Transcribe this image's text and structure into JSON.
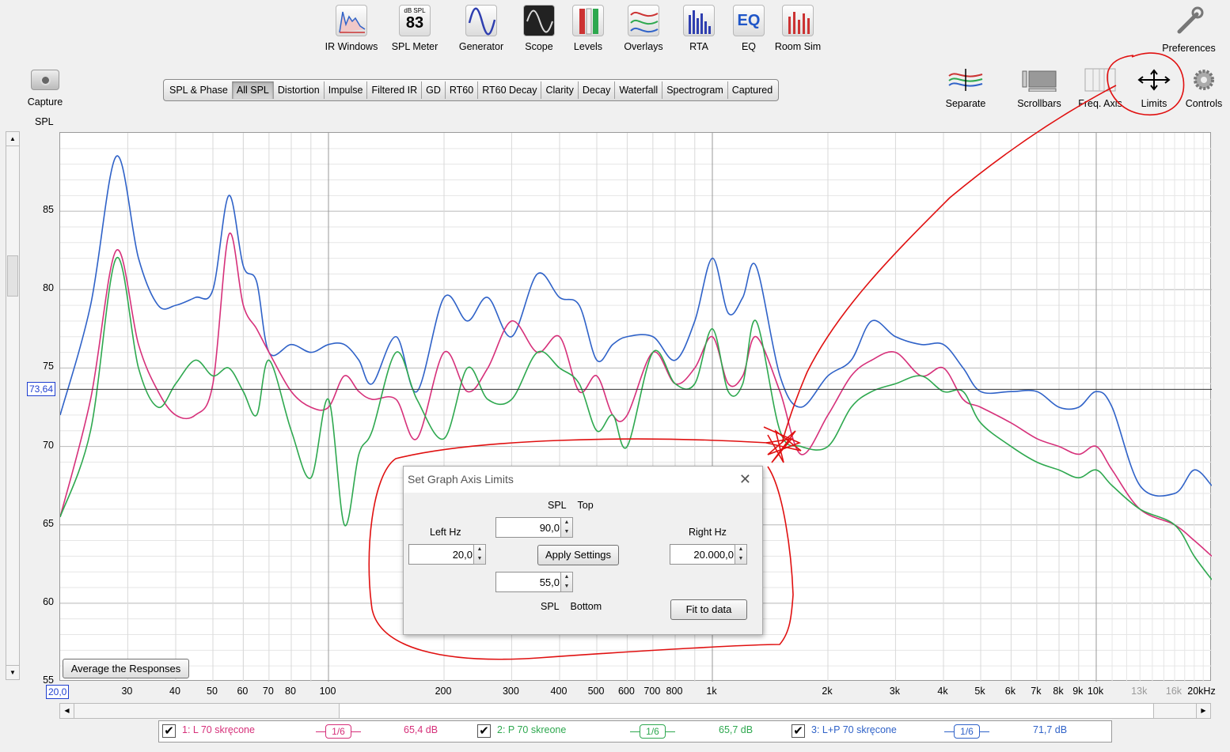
{
  "toolbar": {
    "ir_windows": "IR Windows",
    "spl_meter_top": "dB SPL",
    "spl_meter_value": "83",
    "spl_meter": "SPL Meter",
    "generator": "Generator",
    "scope": "Scope",
    "levels": "Levels",
    "overlays": "Overlays",
    "rta": "RTA",
    "eq_icon": "EQ",
    "eq": "EQ",
    "room_sim": "Room Sim",
    "preferences": "Preferences"
  },
  "capture": "Capture",
  "tabs": [
    "SPL & Phase",
    "All SPL",
    "Distortion",
    "Impulse",
    "Filtered IR",
    "GD",
    "RT60",
    "RT60 Decay",
    "Clarity",
    "Decay",
    "Waterfall",
    "Spectrogram",
    "Captured"
  ],
  "right_tools": {
    "separate": "Separate",
    "scrollbars": "Scrollbars",
    "freq_axis": "Freq. Axis",
    "limits": "Limits",
    "controls": "Controls"
  },
  "axis": {
    "ylabel": "SPL",
    "y_ticks": [
      "85",
      "80",
      "75",
      "70",
      "65",
      "60",
      "55"
    ],
    "x_ticks": [
      "30",
      "40",
      "50",
      "60",
      "70",
      "80",
      "100",
      "200",
      "300",
      "400",
      "500",
      "600",
      "700",
      "800",
      "1k",
      "2k",
      "3k",
      "4k",
      "5k",
      "6k",
      "7k",
      "8k",
      "9k",
      "10k",
      "13k",
      "16k",
      "20kHz"
    ],
    "x_min_box": "20,0",
    "cursor_spl": "73,64"
  },
  "average_button": "Average the Responses",
  "dialog": {
    "title": "Set Graph Axis Limits",
    "spl_top_a": "SPL",
    "spl_top_b": "Top",
    "left_label": "Left Hz",
    "left_value": "20,0",
    "top_value": "90,0",
    "apply": "Apply Settings",
    "right_label": "Right Hz",
    "right_value": "20.000,0",
    "bottom_value": "55,0",
    "spl_bottom_a": "SPL",
    "spl_bottom_b": "Bottom",
    "fit": "Fit to data"
  },
  "legend": [
    {
      "name": "1: L 70 skręcone",
      "smoothing": "1/6",
      "level": "65,4 dB",
      "color": "#d6307a"
    },
    {
      "name": "2: P 70 skreone",
      "smoothing": "1/6",
      "level": "65,7 dB",
      "color": "#2ea84f"
    },
    {
      "name": "3: L+P 70 skręcone",
      "smoothing": "1/6",
      "level": "71,7 dB",
      "color": "#2f62c8"
    }
  ],
  "chart_data": {
    "type": "line",
    "xscale": "log",
    "xlim": [
      20,
      20000
    ],
    "ylim": [
      55,
      90
    ],
    "ylabel": "SPL",
    "cursor_y": 73.64,
    "x": [
      20,
      24,
      28,
      32,
      36,
      40,
      45,
      50,
      55,
      60,
      65,
      70,
      80,
      90,
      100,
      110,
      120,
      130,
      150,
      170,
      200,
      230,
      260,
      300,
      350,
      400,
      450,
      500,
      550,
      600,
      700,
      800,
      900,
      1000,
      1100,
      1200,
      1300,
      1500,
      1700,
      2000,
      2300,
      2600,
      3000,
      3500,
      4000,
      4500,
      5000,
      6000,
      7000,
      8000,
      9000,
      10000,
      11000,
      13000,
      16000,
      18000,
      20000
    ],
    "series": [
      {
        "name": "3: L+P 70 skręcone",
        "values": [
          72,
          79,
          88.5,
          82,
          79,
          79,
          79.5,
          80,
          86,
          81.5,
          80.5,
          76,
          76.5,
          76,
          76.5,
          76.5,
          75.5,
          74,
          77,
          73.5,
          79.5,
          78,
          79.5,
          77,
          81,
          79.5,
          79,
          75.5,
          76.5,
          77,
          77,
          75.5,
          78,
          82,
          78.5,
          79.5,
          81.5,
          74.5,
          72.5,
          74.5,
          75.5,
          78,
          77,
          76.5,
          76.5,
          75,
          73.5,
          73.5,
          73.5,
          72.5,
          72.5,
          73.5,
          72.5,
          67.5,
          67,
          68.5,
          67.5
        ]
      },
      {
        "name": "1: L 70 skręcone",
        "values": [
          65.5,
          73,
          82.5,
          76.5,
          73.5,
          72,
          72,
          74,
          83.5,
          79,
          77.5,
          76,
          73.5,
          72.5,
          72.5,
          74.5,
          73.5,
          73,
          73,
          70.5,
          76,
          73.5,
          75,
          78,
          76,
          77,
          73.5,
          74.5,
          72,
          72,
          76,
          74,
          75,
          77,
          74,
          74.5,
          77,
          73.5,
          69.5,
          72,
          74.5,
          75.5,
          76,
          74.5,
          75,
          73,
          72.5,
          71.5,
          70.5,
          70,
          69.5,
          70,
          68.5,
          66,
          65,
          64,
          63
        ]
      },
      {
        "name": "2: P 70 skreone",
        "values": [
          65.5,
          71,
          82,
          75,
          72.5,
          74,
          75.5,
          74.5,
          75,
          73.5,
          72,
          75.5,
          71,
          68,
          73,
          65,
          69.5,
          71,
          76,
          73,
          70.5,
          75,
          73,
          73,
          76,
          75,
          74,
          71,
          72,
          70,
          76,
          74,
          74,
          77.5,
          73.5,
          74,
          78,
          71,
          70,
          70,
          72.5,
          73.5,
          74,
          74.5,
          73.5,
          73.5,
          71.5,
          70,
          69,
          68.5,
          68,
          68.5,
          67.5,
          66,
          65,
          63,
          61.5
        ]
      }
    ]
  }
}
